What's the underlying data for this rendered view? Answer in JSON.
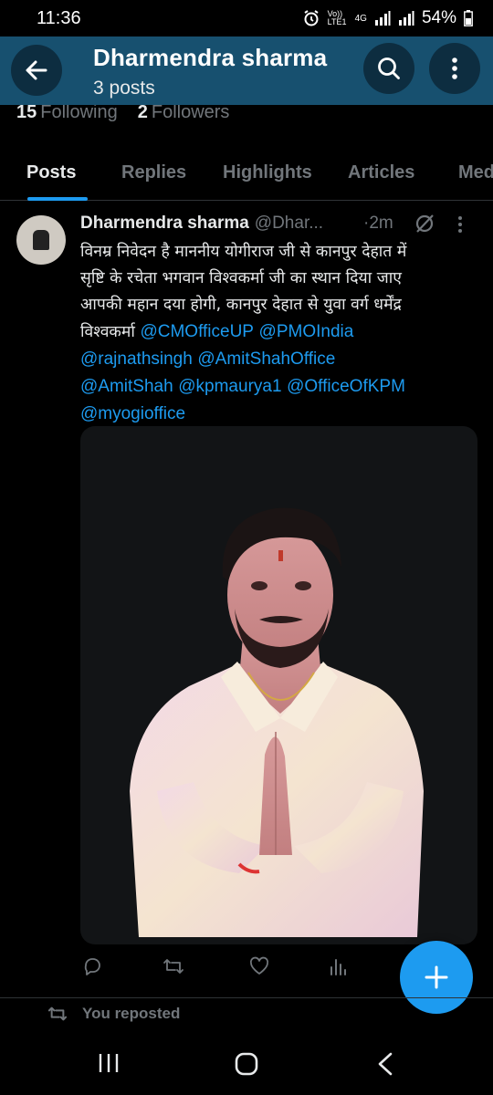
{
  "status_bar": {
    "time": "11:36",
    "network_label": "Vo)) LTE1",
    "network_type": "4G",
    "battery": "54%"
  },
  "header": {
    "title": "Dharmendra sharma",
    "subtitle": "3 posts",
    "back_icon": "arrow-left-icon",
    "search_icon": "search-icon",
    "more_icon": "more-vertical-icon"
  },
  "profile": {
    "following_count": "15",
    "following_label": "Following",
    "followers_count": "2",
    "followers_label": "Followers"
  },
  "tabs": [
    {
      "label": "Posts",
      "active": true
    },
    {
      "label": "Replies",
      "active": false
    },
    {
      "label": "Highlights",
      "active": false
    },
    {
      "label": "Articles",
      "active": false
    },
    {
      "label": "Med",
      "active": false
    }
  ],
  "tweet": {
    "author_name": "Dharmendra sharma",
    "author_handle": "@Dhar...",
    "time": "·2m",
    "text_lines": [
      "विनम्र निवेदन है माननीय योगीराज जी से कानपुर देहात में",
      "सृष्टि के रचेता भगवान विश्वकर्मा जी का स्थान दिया जाए",
      "आपकी महान दया होगी, कानपुर देहात से युवा वर्ग धर्मेंद्र"
    ],
    "text_line4_prefix": "विश्वकर्मा",
    "mentions": [
      "@CMOfficeUP",
      "@PMOIndia",
      "@rajnathsingh",
      "@AmitShahOffice",
      "@AmitShah",
      "@kpmaurya1",
      "@OfficeOfKPM",
      "@myogioffice"
    ],
    "actions": [
      "reply-icon",
      "repost-icon",
      "like-icon",
      "views-icon",
      "share-icon"
    ]
  },
  "reposted": {
    "label": "You reposted"
  },
  "fab": {
    "icon": "plus-icon"
  },
  "nav": [
    "recents-icon",
    "home-icon",
    "back-icon"
  ],
  "colors": {
    "accent": "#1d9bf0",
    "header_bg": "#17506f",
    "text_primary": "#e7e9ea",
    "text_secondary": "#71767b"
  }
}
